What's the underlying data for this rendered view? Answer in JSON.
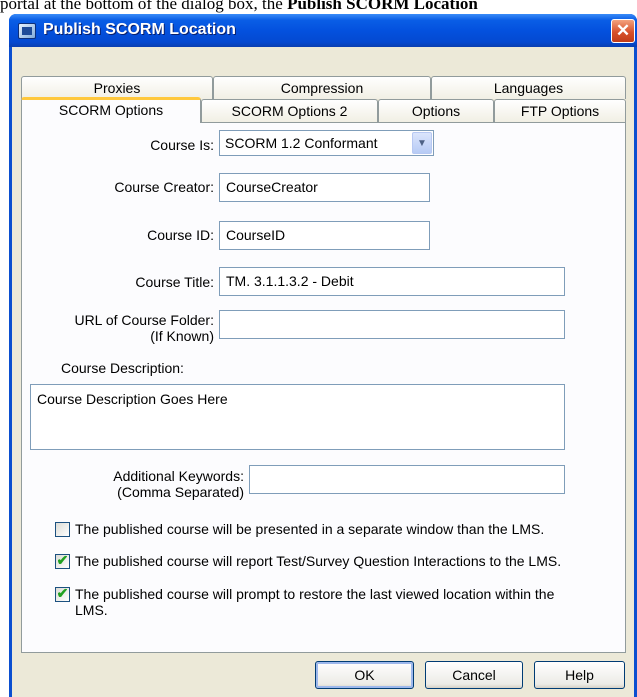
{
  "background_page": {
    "text_plain": "portal at the bottom of the dialog box, the ",
    "text_bold": "Publish SCORM Location"
  },
  "dialog": {
    "title": "Publish SCORM Location",
    "close_glyph": "✕"
  },
  "tabs": {
    "row_back": [
      "Proxies",
      "Compression",
      "Languages"
    ],
    "row_front": [
      "SCORM Options",
      "SCORM Options 2",
      "Options",
      "FTP Options"
    ],
    "active": "SCORM Options"
  },
  "form": {
    "course_is": {
      "label": "Course Is:",
      "value": "SCORM 1.2 Conformant"
    },
    "course_creator": {
      "label": "Course Creator:",
      "value": "CourseCreator"
    },
    "course_id": {
      "label": "Course ID:",
      "value": "CourseID"
    },
    "course_title": {
      "label": "Course Title:",
      "value": "TM. 3.1.1.3.2 - Debit"
    },
    "course_url": {
      "label_line1": "URL of Course Folder:",
      "label_line2": "(If Known)",
      "value": ""
    },
    "course_description": {
      "label": "Course Description:",
      "value": "Course Description Goes Here"
    },
    "keywords": {
      "label_line1": "Additional Keywords:",
      "label_line2": "(Comma Separated)",
      "value": ""
    }
  },
  "checkboxes": [
    {
      "label": "The published course will be presented in a separate window than the LMS.",
      "checked": false
    },
    {
      "label": "The published course will report Test/Survey Question Interactions to the LMS.",
      "checked": true
    },
    {
      "label_line1": "The published course will prompt to restore the last viewed location within the",
      "label_line2": "LMS.",
      "checked": true
    }
  ],
  "check_glyph": "✔",
  "dropdown_arrow_glyph": "▼",
  "buttons": {
    "ok": "OK",
    "cancel": "Cancel",
    "help": "Help"
  },
  "colors": {
    "titlebar": "#0451de",
    "dialog_face": "#ece9d8",
    "active_tab_accent": "#ffc83c",
    "close_button": "#d8512b"
  }
}
